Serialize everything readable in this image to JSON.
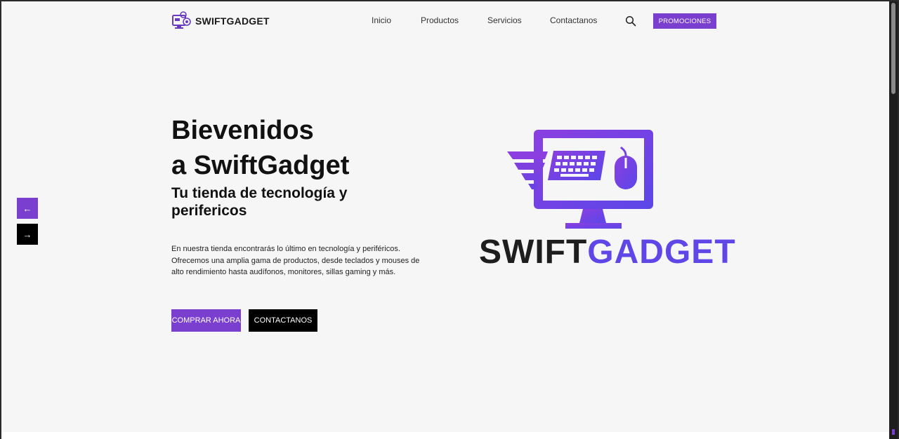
{
  "header": {
    "brand": "SWIFTGADGET",
    "nav": [
      {
        "label": "Inicio"
      },
      {
        "label": "Productos"
      },
      {
        "label": "Servicios"
      },
      {
        "label": "Contactanos"
      }
    ],
    "search_icon": "search-icon",
    "promo_label": "PROMOCIONES"
  },
  "hero": {
    "title_line1": "Bievenidos",
    "title_line2": "a SwiftGadget",
    "subtitle": "Tu tienda de tecnología y perifericos",
    "description": "En nuestra tienda encontrarás lo último en tecnología y periféricos. Ofrecemos una amplia gama de productos, desde teclados y mouses de alto rendimiento hasta audífonos, monitores, sillas gaming y más.",
    "buy_label": "COMPRAR AHORA",
    "contact_label": "CONTACTANOS",
    "logo_word_part1": "SWIFT",
    "logo_word_part2": "GADGET"
  },
  "slider": {
    "prev_icon": "arrow-left-icon",
    "next_icon": "arrow-right-icon"
  },
  "colors": {
    "accent": "#7b3fd0",
    "logo_blue": "#5f46e6",
    "background": "#f6f6f6"
  }
}
